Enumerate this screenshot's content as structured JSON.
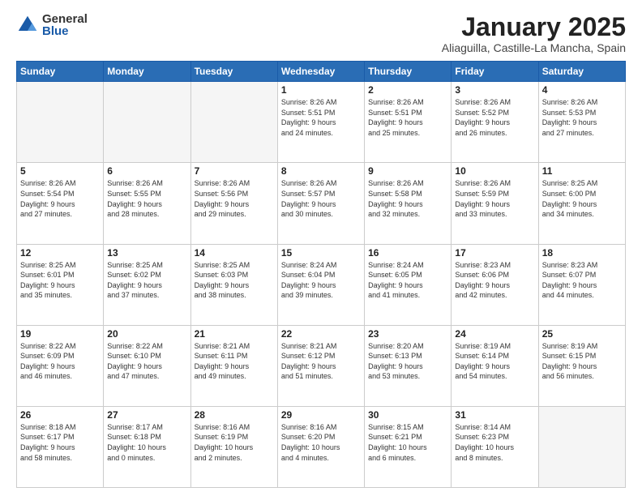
{
  "logo": {
    "general": "General",
    "blue": "Blue"
  },
  "title": {
    "month": "January 2025",
    "location": "Aliaguilla, Castille-La Mancha, Spain"
  },
  "weekdays": [
    "Sunday",
    "Monday",
    "Tuesday",
    "Wednesday",
    "Thursday",
    "Friday",
    "Saturday"
  ],
  "days": [
    {
      "num": "",
      "info": ""
    },
    {
      "num": "",
      "info": ""
    },
    {
      "num": "",
      "info": ""
    },
    {
      "num": "1",
      "info": "Sunrise: 8:26 AM\nSunset: 5:51 PM\nDaylight: 9 hours\nand 24 minutes."
    },
    {
      "num": "2",
      "info": "Sunrise: 8:26 AM\nSunset: 5:51 PM\nDaylight: 9 hours\nand 25 minutes."
    },
    {
      "num": "3",
      "info": "Sunrise: 8:26 AM\nSunset: 5:52 PM\nDaylight: 9 hours\nand 26 minutes."
    },
    {
      "num": "4",
      "info": "Sunrise: 8:26 AM\nSunset: 5:53 PM\nDaylight: 9 hours\nand 27 minutes."
    },
    {
      "num": "5",
      "info": "Sunrise: 8:26 AM\nSunset: 5:54 PM\nDaylight: 9 hours\nand 27 minutes."
    },
    {
      "num": "6",
      "info": "Sunrise: 8:26 AM\nSunset: 5:55 PM\nDaylight: 9 hours\nand 28 minutes."
    },
    {
      "num": "7",
      "info": "Sunrise: 8:26 AM\nSunset: 5:56 PM\nDaylight: 9 hours\nand 29 minutes."
    },
    {
      "num": "8",
      "info": "Sunrise: 8:26 AM\nSunset: 5:57 PM\nDaylight: 9 hours\nand 30 minutes."
    },
    {
      "num": "9",
      "info": "Sunrise: 8:26 AM\nSunset: 5:58 PM\nDaylight: 9 hours\nand 32 minutes."
    },
    {
      "num": "10",
      "info": "Sunrise: 8:26 AM\nSunset: 5:59 PM\nDaylight: 9 hours\nand 33 minutes."
    },
    {
      "num": "11",
      "info": "Sunrise: 8:25 AM\nSunset: 6:00 PM\nDaylight: 9 hours\nand 34 minutes."
    },
    {
      "num": "12",
      "info": "Sunrise: 8:25 AM\nSunset: 6:01 PM\nDaylight: 9 hours\nand 35 minutes."
    },
    {
      "num": "13",
      "info": "Sunrise: 8:25 AM\nSunset: 6:02 PM\nDaylight: 9 hours\nand 37 minutes."
    },
    {
      "num": "14",
      "info": "Sunrise: 8:25 AM\nSunset: 6:03 PM\nDaylight: 9 hours\nand 38 minutes."
    },
    {
      "num": "15",
      "info": "Sunrise: 8:24 AM\nSunset: 6:04 PM\nDaylight: 9 hours\nand 39 minutes."
    },
    {
      "num": "16",
      "info": "Sunrise: 8:24 AM\nSunset: 6:05 PM\nDaylight: 9 hours\nand 41 minutes."
    },
    {
      "num": "17",
      "info": "Sunrise: 8:23 AM\nSunset: 6:06 PM\nDaylight: 9 hours\nand 42 minutes."
    },
    {
      "num": "18",
      "info": "Sunrise: 8:23 AM\nSunset: 6:07 PM\nDaylight: 9 hours\nand 44 minutes."
    },
    {
      "num": "19",
      "info": "Sunrise: 8:22 AM\nSunset: 6:09 PM\nDaylight: 9 hours\nand 46 minutes."
    },
    {
      "num": "20",
      "info": "Sunrise: 8:22 AM\nSunset: 6:10 PM\nDaylight: 9 hours\nand 47 minutes."
    },
    {
      "num": "21",
      "info": "Sunrise: 8:21 AM\nSunset: 6:11 PM\nDaylight: 9 hours\nand 49 minutes."
    },
    {
      "num": "22",
      "info": "Sunrise: 8:21 AM\nSunset: 6:12 PM\nDaylight: 9 hours\nand 51 minutes."
    },
    {
      "num": "23",
      "info": "Sunrise: 8:20 AM\nSunset: 6:13 PM\nDaylight: 9 hours\nand 53 minutes."
    },
    {
      "num": "24",
      "info": "Sunrise: 8:19 AM\nSunset: 6:14 PM\nDaylight: 9 hours\nand 54 minutes."
    },
    {
      "num": "25",
      "info": "Sunrise: 8:19 AM\nSunset: 6:15 PM\nDaylight: 9 hours\nand 56 minutes."
    },
    {
      "num": "26",
      "info": "Sunrise: 8:18 AM\nSunset: 6:17 PM\nDaylight: 9 hours\nand 58 minutes."
    },
    {
      "num": "27",
      "info": "Sunrise: 8:17 AM\nSunset: 6:18 PM\nDaylight: 10 hours\nand 0 minutes."
    },
    {
      "num": "28",
      "info": "Sunrise: 8:16 AM\nSunset: 6:19 PM\nDaylight: 10 hours\nand 2 minutes."
    },
    {
      "num": "29",
      "info": "Sunrise: 8:16 AM\nSunset: 6:20 PM\nDaylight: 10 hours\nand 4 minutes."
    },
    {
      "num": "30",
      "info": "Sunrise: 8:15 AM\nSunset: 6:21 PM\nDaylight: 10 hours\nand 6 minutes."
    },
    {
      "num": "31",
      "info": "Sunrise: 8:14 AM\nSunset: 6:23 PM\nDaylight: 10 hours\nand 8 minutes."
    },
    {
      "num": "",
      "info": ""
    }
  ]
}
